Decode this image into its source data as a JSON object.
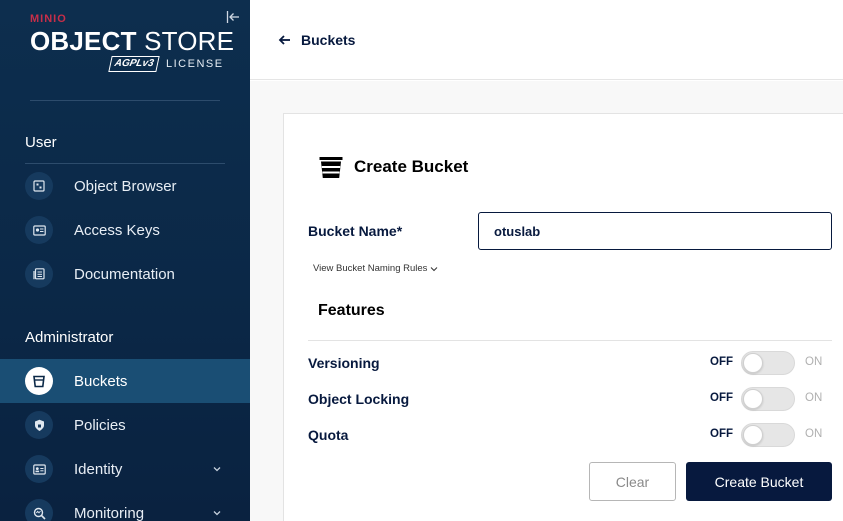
{
  "brand": {
    "minio": "MINIO",
    "product_bold": "OBJECT",
    "product_light": " STORE",
    "agpl": "AGPLv3",
    "license": "LICENSE"
  },
  "sidebar": {
    "user_section": "User",
    "user_items": [
      {
        "label": "Object Browser",
        "icon": "object-browser-icon"
      },
      {
        "label": "Access Keys",
        "icon": "access-keys-icon"
      },
      {
        "label": "Documentation",
        "icon": "documentation-icon"
      }
    ],
    "admin_section": "Administrator",
    "admin_items": [
      {
        "label": "Buckets",
        "icon": "bucket-icon",
        "active": true
      },
      {
        "label": "Policies",
        "icon": "policies-icon"
      },
      {
        "label": "Identity",
        "icon": "identity-icon",
        "expandable": true
      },
      {
        "label": "Monitoring",
        "icon": "monitoring-icon",
        "expandable": true
      }
    ]
  },
  "header": {
    "back_label": "Buckets"
  },
  "form": {
    "title": "Create Bucket",
    "bucket_name_label": "Bucket Name*",
    "bucket_name_value": "otuslab",
    "naming_rules": "View Bucket Naming Rules",
    "features_title": "Features",
    "features": [
      {
        "name": "Versioning",
        "off": "OFF",
        "on": "ON",
        "enabled": false
      },
      {
        "name": "Object Locking",
        "off": "OFF",
        "on": "ON",
        "enabled": false
      },
      {
        "name": "Quota",
        "off": "OFF",
        "on": "ON",
        "enabled": false
      }
    ],
    "clear_label": "Clear",
    "create_label": "Create Bucket"
  },
  "colors": {
    "sidebar_bg": "#0b2847",
    "active_bg": "#1a4e74",
    "brand_red": "#c72e49",
    "primary": "#07193e"
  }
}
